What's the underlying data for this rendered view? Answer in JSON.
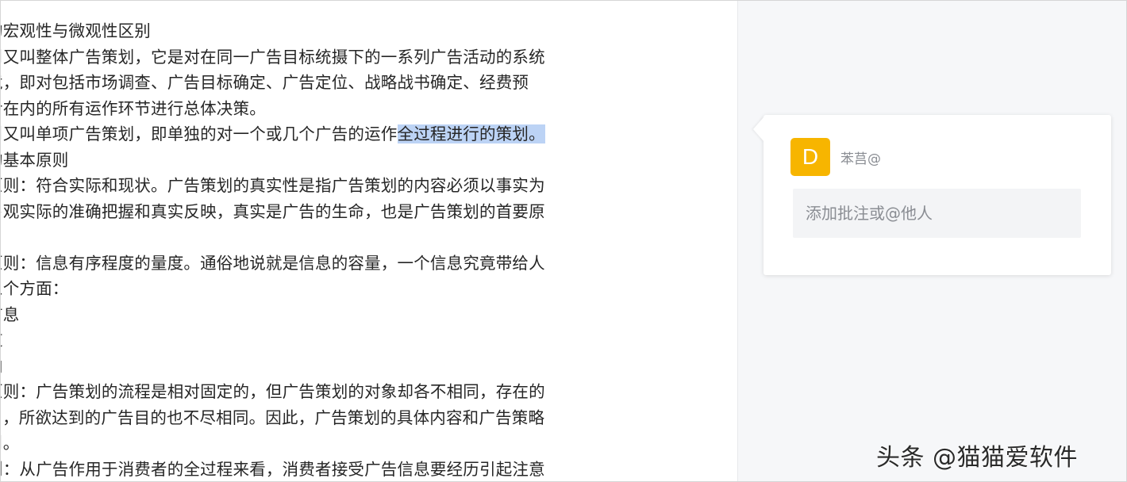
{
  "document": {
    "lines": [
      "的宏观性与微观性区别",
      "刂又叫整体广告策划，它是对在同一广告目标统摄下的一系列广告活动的系统",
      "竟，即对包括市场调查、广告目标确定、广告定位、战略战书确定、经费预",
      "舌在内的所有运作环节进行总体决策。",
      "",
      "的基本原则",
      "原则：符合实际和现状。广告策划的真实性是指广告策划的内容必须以事实为",
      "卜观实际的准确把握和真实反映，真实是广告的生命，也是广告策划的首要原",
      "",
      "原则：信息有序程度的量度。通俗地说就是信息的容量，一个信息究竟带给人",
      "三个方面：",
      "言息",
      "道",
      "向",
      "原则：广告策划的流程是相对固定的，但广告策划的对象却各不相同，存在的",
      "リ，所欲达到的广告目的也不尽相同。因此，广告策划的具体内容和广告策略",
      "刂。",
      "则：从广告作用于消费者的全过程来看，消费者接受广告信息要经历引起注意"
    ],
    "highlight_line": {
      "before": "刂又叫单项广告策划，即单独的对一个或几个广告的运作",
      "selected": "全过程进行的策划。"
    }
  },
  "comment": {
    "avatar_letter": "D",
    "username": "苯莒@",
    "placeholder": "添加批注或@他人"
  },
  "watermark": "头条 @猫猫爱软件",
  "colors": {
    "avatar": "#f7b500",
    "selection": "#bcd3f5",
    "rail": "#f6f7f9"
  }
}
